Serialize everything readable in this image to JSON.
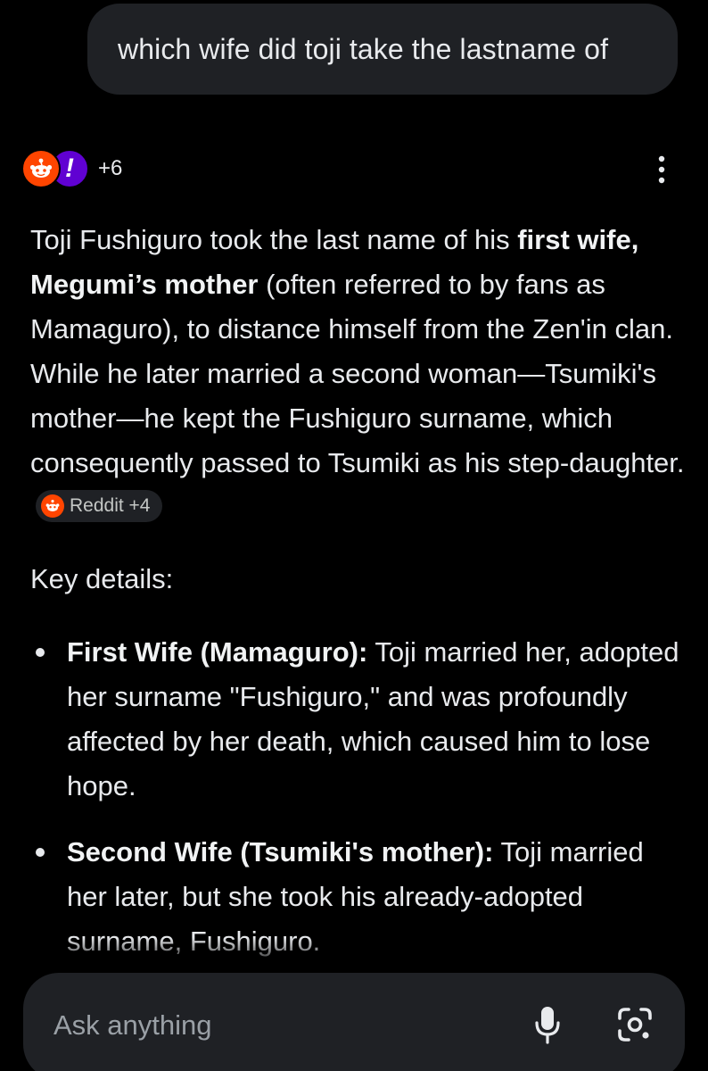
{
  "query": {
    "text": "which wife did toji take the lastname of"
  },
  "sources": {
    "icons": [
      "reddit-icon",
      "yahoo-icon"
    ],
    "more_count": "+6",
    "colors": {
      "reddit": "#ff4500",
      "yahoo": "#6001d2"
    }
  },
  "answer": {
    "p1_a": "Toji Fushiguro took the last name of his ",
    "p1_bold": "first wife, Megumi’s mother",
    "p1_b": " (often referred to by fans as Mamaguro), to distance himself from the Zen'in clan. While he later married a second woman—Tsumiki's mother—he kept the Fushiguro surname, which consequently passed to Tsumiki as his step-daughter.",
    "citation": {
      "label": "Reddit +4",
      "icon": "reddit-icon"
    }
  },
  "key_details": {
    "heading": "Key details:",
    "items": [
      {
        "title": "First Wife (Mamaguro):",
        "text": " Toji married her, adopted her surname \"Fushiguro,\" and was profoundly affected by her death, which caused him to lose hope."
      },
      {
        "title": "Second Wife (Tsumiki's mother):",
        "text": " Toji married her later, but she took his already-adopted surname, Fushiguro."
      }
    ]
  },
  "input": {
    "placeholder": "Ask anything",
    "icons": [
      "mic-icon",
      "google-lens-icon"
    ]
  }
}
